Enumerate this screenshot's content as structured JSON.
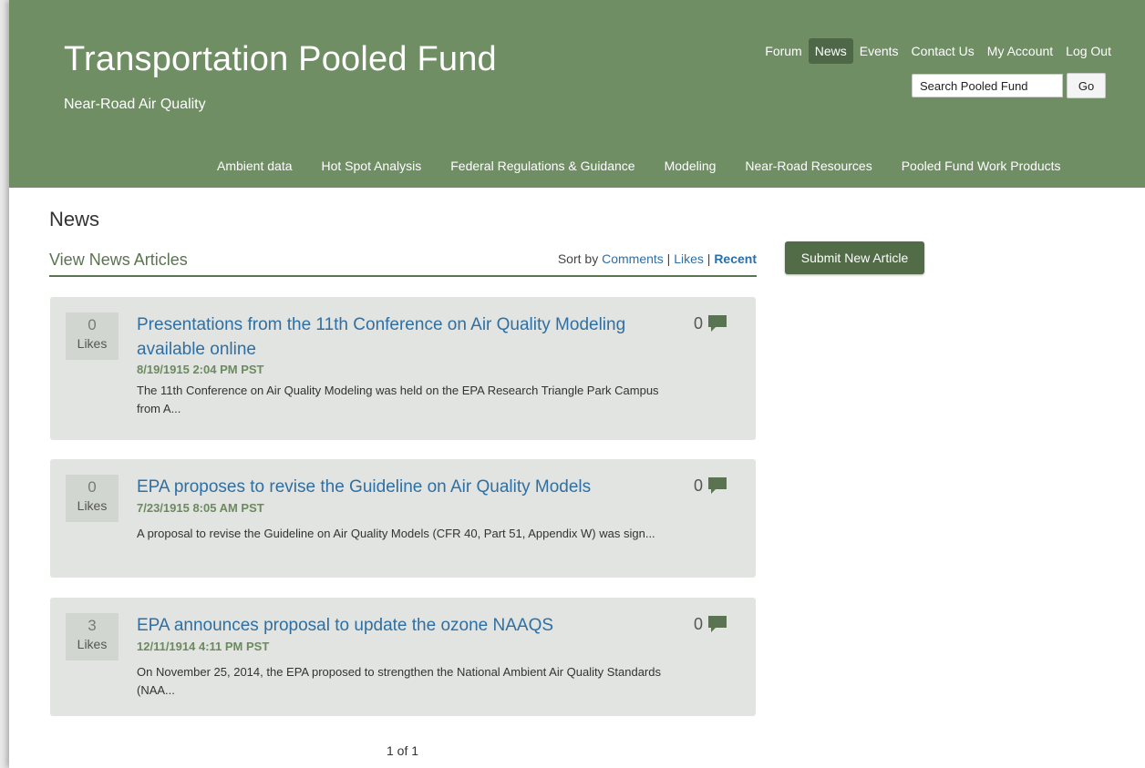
{
  "header": {
    "site_title": "Transportation Pooled Fund",
    "site_subtitle": "Near-Road Air Quality",
    "top_nav": [
      "Forum",
      "News",
      "Events",
      "Contact Us",
      "My Account",
      "Log Out"
    ],
    "active_top_nav": "News",
    "search": {
      "value": "Search Pooled Fund",
      "button": "Go"
    },
    "main_nav": [
      "Ambient data",
      "Hot Spot Analysis",
      "Federal Regulations & Guidance",
      "Modeling",
      "Near-Road Resources",
      "Pooled Fund Work Products"
    ]
  },
  "main": {
    "page_heading": "News",
    "section_title": "View News Articles",
    "sort": {
      "prefix": "Sort by",
      "options": [
        "Comments",
        "Likes",
        "Recent"
      ],
      "current": "Recent",
      "separator": "|"
    },
    "submit_button": "Submit New Article",
    "articles": [
      {
        "likes": "0",
        "likes_label": "Likes",
        "title": "Presentations from the 11th Conference on Air Quality Modeling available online",
        "date": "8/19/1915 2:04 PM PST",
        "summary": "The 11th Conference on Air Quality Modeling was held on the EPA Research Triangle Park Campus from A...",
        "comments": "0"
      },
      {
        "likes": "0",
        "likes_label": "Likes",
        "title": "EPA proposes to revise the Guideline on Air Quality Models",
        "date": "7/23/1915 8:05 AM PST",
        "summary": "A proposal to revise the Guideline on Air Quality Models (CFR 40, Part 51, Appendix W) was sign...",
        "comments": "0"
      },
      {
        "likes": "3",
        "likes_label": "Likes",
        "title": "EPA announces proposal to update the ozone NAAQS",
        "date": "12/11/1914 4:11 PM PST",
        "summary": "On November 25, 2014, the EPA proposed to strengthen the National Ambient Air Quality Standards (NAA...",
        "comments": "0"
      }
    ],
    "pager": "1 of 1"
  },
  "colors": {
    "header_bg": "#6f8e64",
    "active_nav_bg": "#4e6847",
    "button_bg": "#526c48",
    "card_bg": "#e1e4e0",
    "link": "#2f6fa3",
    "date": "#6c8a5f"
  },
  "icons": {
    "comment": "comment-icon"
  }
}
